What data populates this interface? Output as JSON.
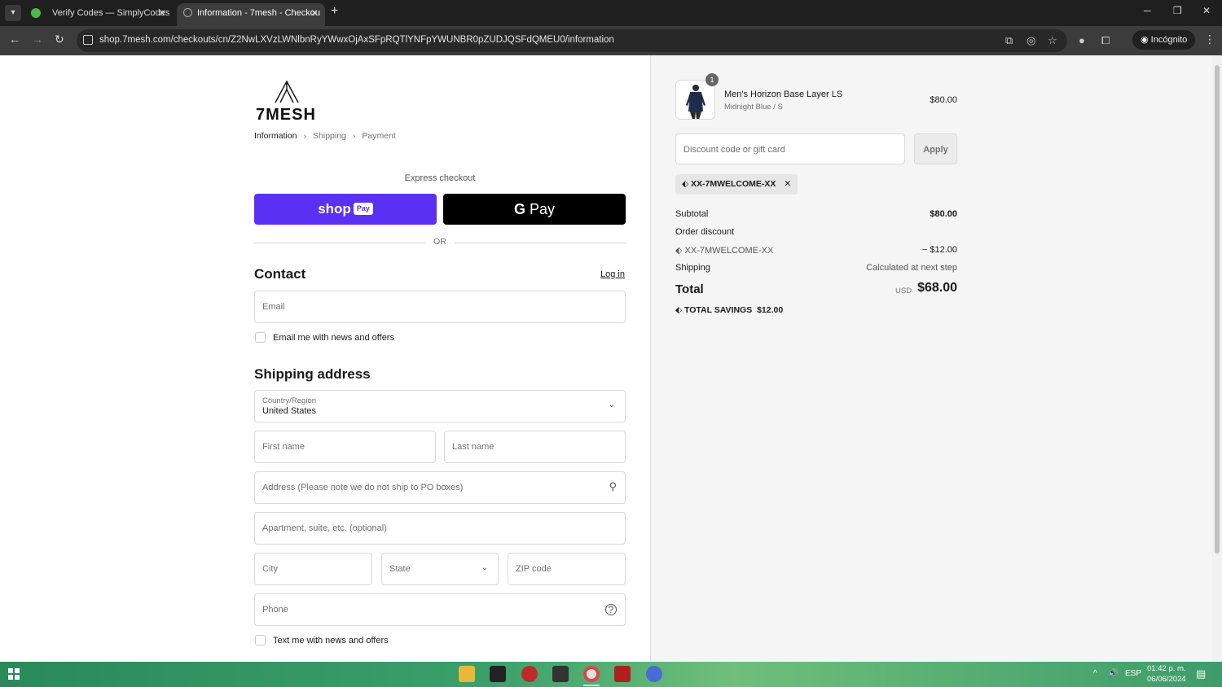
{
  "browser": {
    "tabs": [
      {
        "title": "Verify Codes — SimplyCodes"
      },
      {
        "title": "Information - 7mesh - Checkou"
      }
    ],
    "url": "shop.7mesh.com/checkouts/cn/Z2NwLXVzLWNlbnRyYWwxOjAxSFpRQTlYNFpYWUNBR0pZUDJQSFdQMEU0/information",
    "incognito_label": "Incógnito"
  },
  "brand": {
    "name": "7MESH"
  },
  "breadcrumb": {
    "information": "Information",
    "shipping": "Shipping",
    "payment": "Payment"
  },
  "express": {
    "label": "Express checkout",
    "shop_pay": "shop",
    "shop_pay_badge": "Pay",
    "gpay": "Pay",
    "or": "OR"
  },
  "contact": {
    "heading": "Contact",
    "login": "Log in",
    "email_placeholder": "Email",
    "news_label": "Email me with news and offers"
  },
  "shipping": {
    "heading": "Shipping address",
    "country_label": "Country/Region",
    "country_value": "United States",
    "first_name": "First name",
    "last_name": "Last name",
    "address": "Address (Please note we do not ship to PO boxes)",
    "apartment": "Apartment, suite, etc. (optional)",
    "city": "City",
    "state": "State",
    "zip": "ZIP code",
    "phone": "Phone",
    "sms_label": "Text me with news and offers"
  },
  "summary": {
    "product": {
      "qty": "1",
      "name": "Men's Horizon Base Layer LS",
      "variant": "Midnight Blue / S",
      "price": "$80.00"
    },
    "discount_placeholder": "Discount code or gift card",
    "apply": "Apply",
    "code": "XX-7MWELCOME-XX",
    "subtotal_label": "Subtotal",
    "subtotal": "$80.00",
    "order_discount_label": "Order discount",
    "discount_code": "XX-7MWELCOME-XX",
    "discount_amount": "− $12.00",
    "shipping_label": "Shipping",
    "shipping_value": "Calculated at next step",
    "total_label": "Total",
    "currency": "USD",
    "total": "$68.00",
    "savings_label": "TOTAL SAVINGS",
    "savings": "$12.00"
  },
  "taskbar": {
    "lang": "ESP",
    "time": "01:42 p. m.",
    "date": "06/06/2024"
  },
  "colors": {
    "shop_pay": "#5a31f4",
    "gpay": "#000000",
    "panel_bg": "#f5f5f5"
  }
}
